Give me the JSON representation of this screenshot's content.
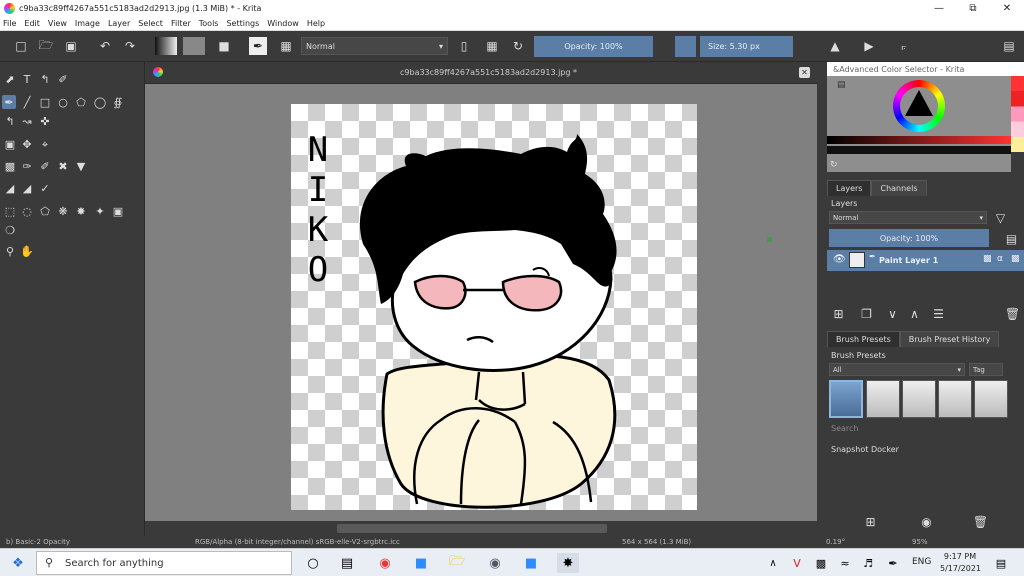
{
  "window": {
    "title": "c9ba33c89ff4267a551c5183ad2d2913.jpg (1.3 MiB)  * - Krita"
  },
  "menu": [
    "File",
    "Edit",
    "View",
    "Image",
    "Layer",
    "Select",
    "Filter",
    "Tools",
    "Settings",
    "Window",
    "Help"
  ],
  "toolbar": {
    "blend_mode": "Normal",
    "opacity_label": "Opacity: 100%",
    "size_label": "Size: 5.30 px"
  },
  "document": {
    "tab_name": "c9ba33c89ff4267a551c5183ad2d2913.jpg *",
    "drawing_text": "NIKO"
  },
  "color_selector": {
    "title": "&Advanced Color Selector - Krita"
  },
  "layers_docker": {
    "tab_layers": "Layers",
    "tab_channels": "Channels",
    "heading": "Layers",
    "blend_mode": "Normal",
    "opacity_label": "Opacity:  100%",
    "layer_name": "Paint Layer 1"
  },
  "brush_docker": {
    "tab_presets": "Brush Presets",
    "tab_history": "Brush Preset History",
    "heading": "Brush Presets",
    "filter": "All",
    "tag_label": "Tag",
    "search_placeholder": "Search"
  },
  "snapshot": {
    "heading": "Snapshot Docker"
  },
  "status": {
    "brush": "b) Basic-2 Opacity",
    "color_space": "RGB/Alpha (8-bit integer/channel)  sRGB-elle-V2-srgbtrc.icc",
    "dimensions": "564 x 564 (1.3 MiB)",
    "rotation": "0.19°",
    "zoom": "95%"
  },
  "taskbar": {
    "search_placeholder": "Search for anything",
    "language": "ENG",
    "time": "9:17 PM",
    "date": "5/17/2021"
  }
}
